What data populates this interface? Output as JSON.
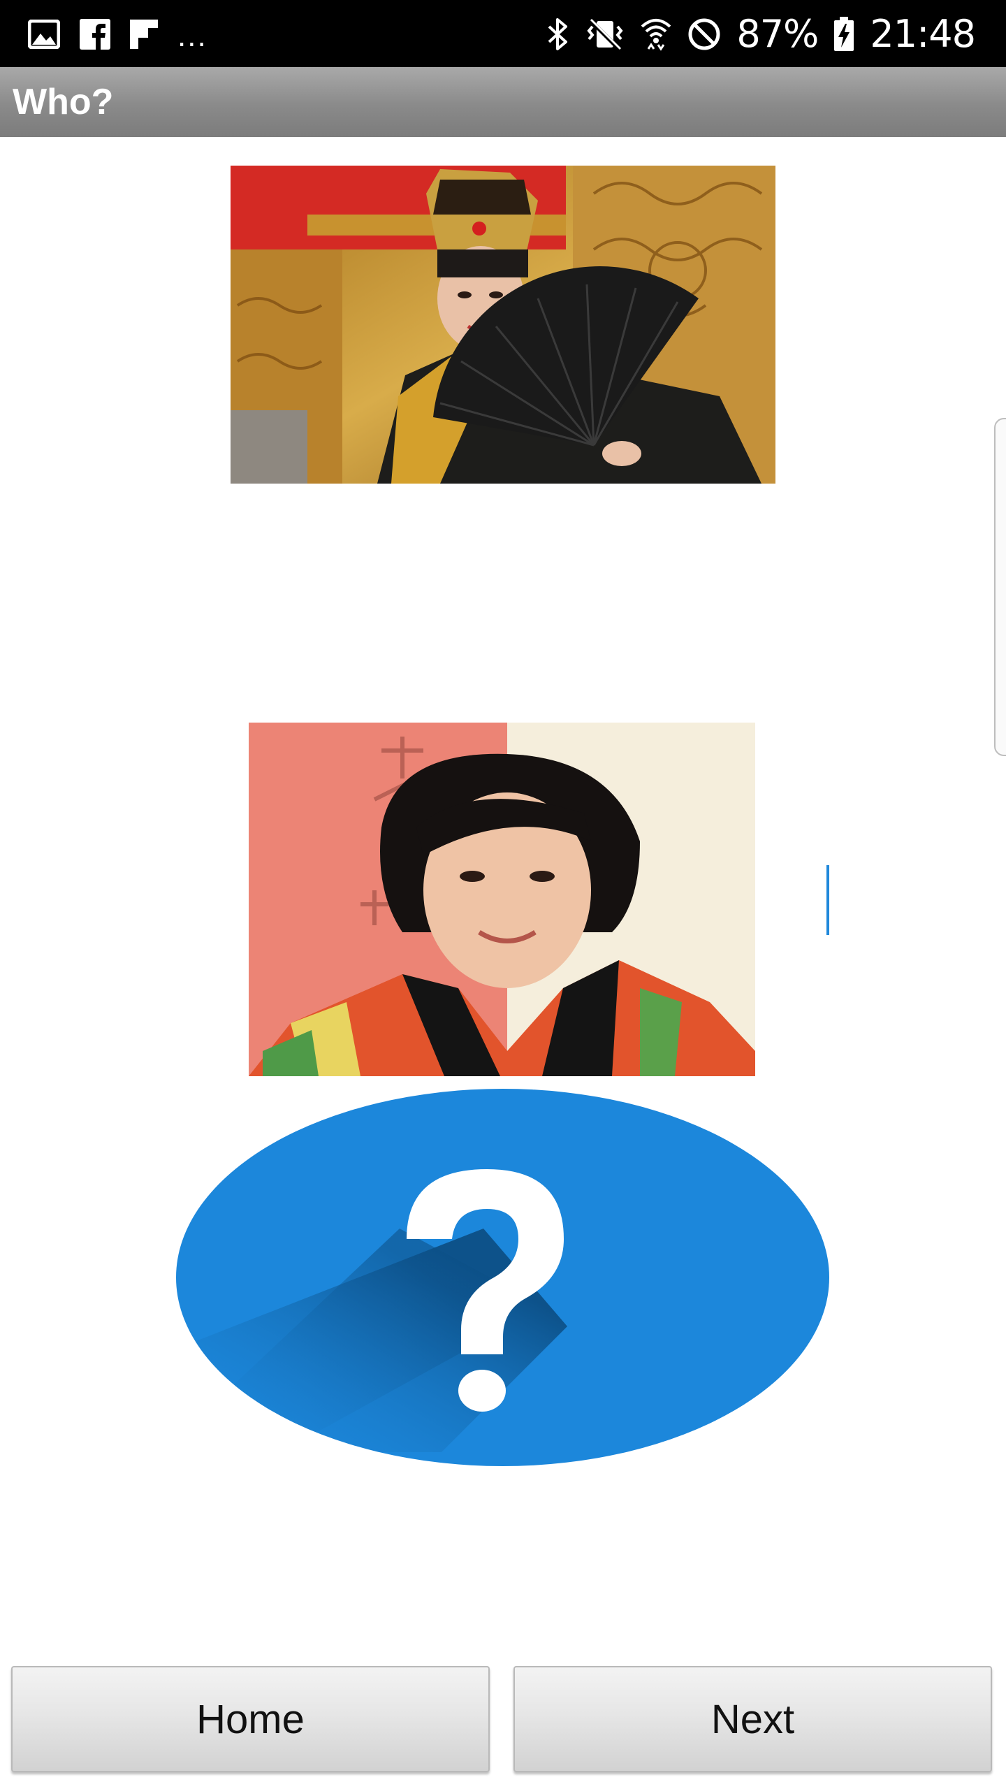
{
  "status_bar": {
    "left_icons": [
      "image-icon",
      "facebook-icon",
      "flipboard-icon"
    ],
    "overflow": "...",
    "right_icons": [
      "bluetooth-icon",
      "vibrate-icon",
      "wifi-icon",
      "do-not-disturb-icon"
    ],
    "battery_percent": "87%",
    "time": "21:48"
  },
  "action_bar": {
    "title": "Who?"
  },
  "photos": [
    {
      "name": "performer-in-costume-photo"
    },
    {
      "name": "woman-portrait-photo"
    }
  ],
  "help_icon": "question-mark-icon",
  "colors": {
    "accent": "#1c87db",
    "action_bar": "#8a8a8a"
  },
  "buttons": {
    "home_label": "Home",
    "next_label": "Next"
  }
}
